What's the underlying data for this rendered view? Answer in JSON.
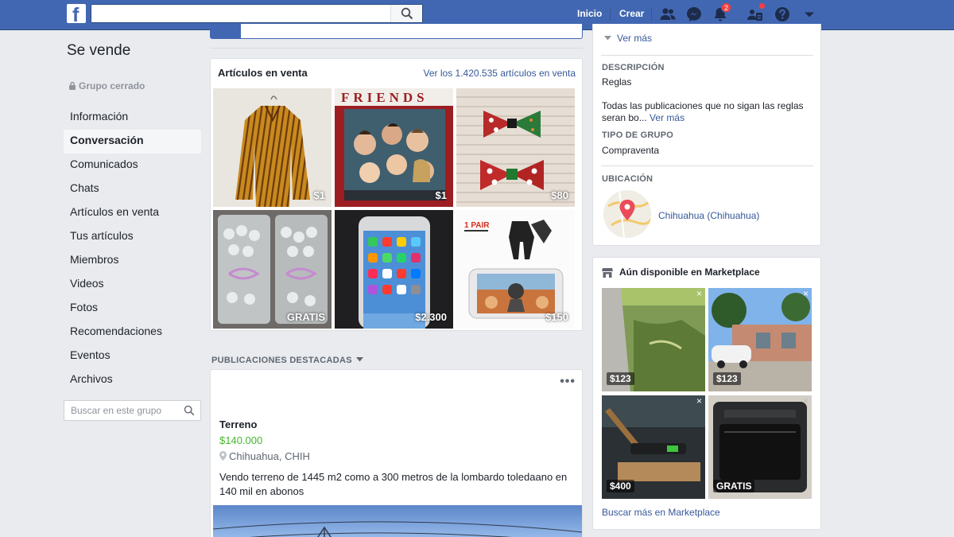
{
  "colors": {
    "brand": "#4267b2",
    "link": "#365899",
    "price_green": "#42b72a",
    "badge_red": "#fa3e3e"
  },
  "topbar": {
    "logo_letter": "f",
    "search_placeholder": "",
    "home_label": "Inicio",
    "create_label": "Crear",
    "notifications_count": "2",
    "icons": [
      "friends-icon",
      "messenger-icon",
      "notifications-icon",
      "groups-icon",
      "help-icon",
      "account-menu-icon"
    ]
  },
  "group": {
    "title": "Se vende",
    "privacy": "Grupo cerrado"
  },
  "left_nav": {
    "items": [
      {
        "label": "Información",
        "active": false
      },
      {
        "label": "Conversación",
        "active": true
      },
      {
        "label": "Comunicados",
        "active": false
      },
      {
        "label": "Chats",
        "active": false
      },
      {
        "label": "Artículos en venta",
        "active": false
      },
      {
        "label": "Tus artículos",
        "active": false
      },
      {
        "label": "Miembros",
        "active": false
      },
      {
        "label": "Videos",
        "active": false
      },
      {
        "label": "Fotos",
        "active": false
      },
      {
        "label": "Recomendaciones",
        "active": false
      },
      {
        "label": "Eventos",
        "active": false
      },
      {
        "label": "Archivos",
        "active": false
      }
    ],
    "search_placeholder": "Buscar en este grupo"
  },
  "sale": {
    "title": "Artículos en venta",
    "see_all": "Ver los 1.420.535 artículos en venta",
    "items": [
      {
        "price": "$1",
        "photo": "striped-blouse"
      },
      {
        "price": "$1",
        "photo": "friends-frame"
      },
      {
        "price": "$80",
        "photo": "hair-bows"
      },
      {
        "price": "GRATIS",
        "photo": "candy-bags"
      },
      {
        "price": "$2.300",
        "photo": "iphone"
      },
      {
        "price": "$150",
        "photo": "phone-triggers",
        "overlay_text": "1 PAIR"
      }
    ]
  },
  "featured": {
    "header": "PUBLICACIONES DESTACADAS",
    "post": {
      "title": "Terreno",
      "price": "$140.000",
      "location": "Chihuahua, CHIH",
      "description": "Vendo terreno de 1445 m2 como a 300 metros de la lombardo toledaano en 140 mil en abonos"
    }
  },
  "about": {
    "see_more": "Ver más",
    "description_label": "DESCRIPCIÓN",
    "description_title": "Reglas",
    "description_text": "Todas las publicaciones que no sigan las reglas seran bo...",
    "description_more": "Ver más",
    "group_type_label": "TIPO DE GRUPO",
    "group_type": "Compraventa",
    "location_label": "UBICACIÓN",
    "location": "Chihuahua (Chihuahua)"
  },
  "marketplace": {
    "title": "Aún disponible en Marketplace",
    "items": [
      {
        "price": "$123",
        "photo": "grass-lot"
      },
      {
        "price": "$123",
        "photo": "house-car"
      },
      {
        "price": "$400",
        "photo": "soldering-tool"
      },
      {
        "price": "GRATIS",
        "photo": "black-appliance"
      }
    ],
    "more_link": "Buscar más en Marketplace"
  }
}
